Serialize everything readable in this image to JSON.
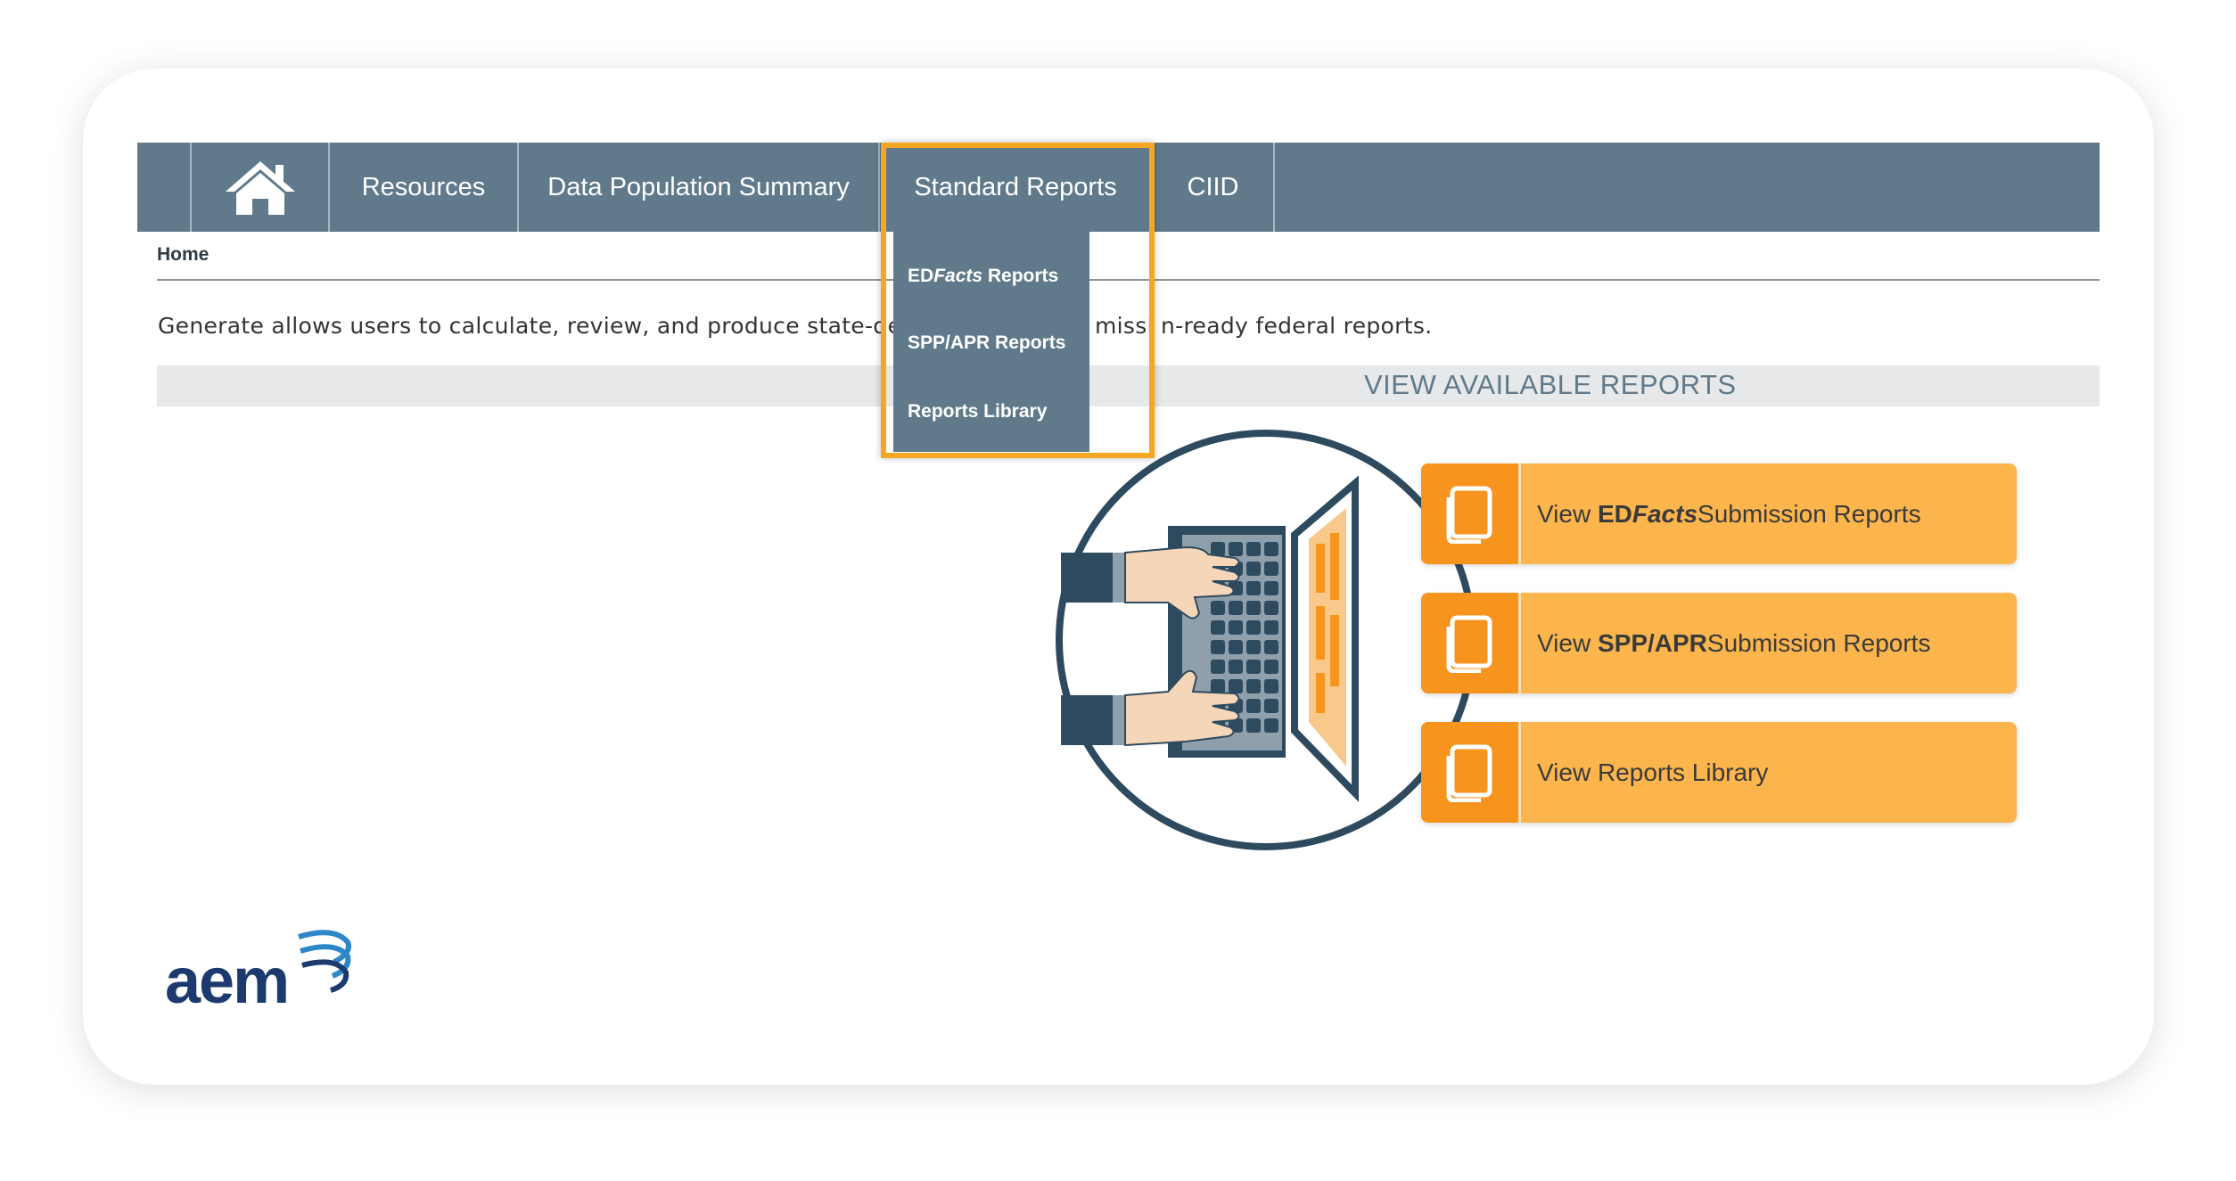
{
  "nav": {
    "resources": "Resources",
    "data_population_summary": "Data Population Summary",
    "standard_reports": "Standard Reports",
    "ciid": "CIID"
  },
  "dropdown": {
    "edfacts_prefix": "ED",
    "edfacts_italic": "Facts",
    "edfacts_suffix": " Reports",
    "spp_apr": "SPP/APR Reports",
    "library": "Reports Library"
  },
  "breadcrumb": "Home",
  "intro_text": "Generate allows users to calculate, review, and produce state-defin",
  "intro_text_tail": "missi n-ready federal reports.",
  "section_title": "VIEW AVAILABLE REPORTS",
  "reports": {
    "edfacts": {
      "prefix": "View ",
      "bold_a": "ED",
      "bold_italic": "Facts",
      "suffix": " Submission Reports"
    },
    "spp": {
      "prefix": "View ",
      "bold": "SPP/APR",
      "suffix": " Submission Reports"
    },
    "library": {
      "label": "View Reports Library"
    }
  },
  "logo_text": "aem",
  "colors": {
    "nav_bg": "#607a8b",
    "highlight": "#f5a623",
    "button_bg": "#fbb54c",
    "button_icon_bg": "#f7941d",
    "logo_navy": "#1d3a6e",
    "logo_blue": "#2b87c8"
  }
}
